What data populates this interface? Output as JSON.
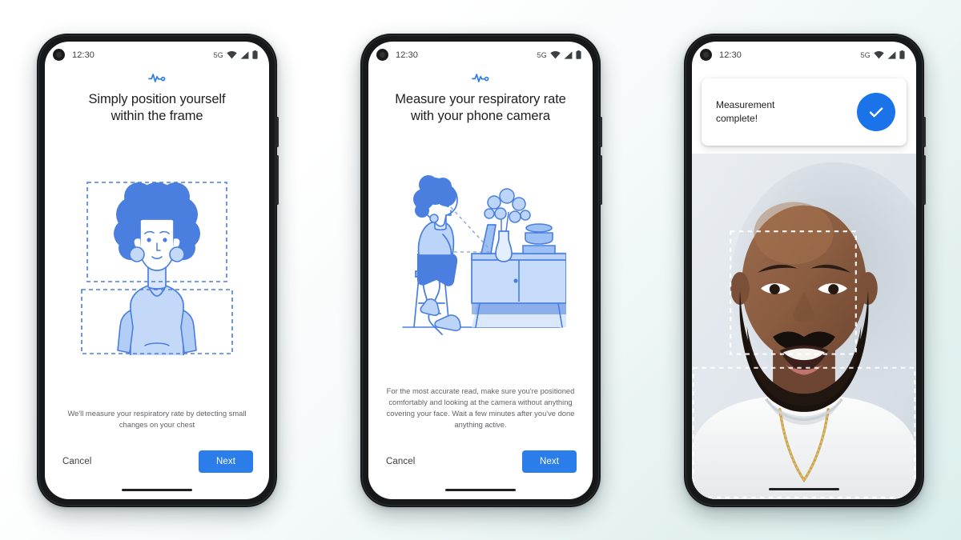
{
  "scene": {
    "background_start": "#ffffff",
    "background_end": "#dcefee",
    "phone_count": 3
  },
  "theme": {
    "accent_blue": "#2b7de9",
    "check_blue": "#1a73e8",
    "illustration_blue": "#4a7fe0",
    "illustration_light": "#bcd3f5",
    "text_primary": "#202124",
    "text_secondary": "#5f6368",
    "dashed_frame": "#4a7fe0"
  },
  "status_bar": {
    "time": "12:30",
    "network": "5G",
    "wifi_icon": "wifi-icon",
    "signal_icon": "cellular-signal-icon",
    "battery_icon": "battery-full-icon",
    "camera_icon": "front-camera-punch-hole"
  },
  "phones": [
    {
      "id": "phone-position",
      "pulse_icon": "respiratory-pulse-icon",
      "headline": "Simply position yourself\nwithin the frame",
      "illustration": "person-in-frame-illustration",
      "caption": "We'll measure your respiratory rate by detecting small changes on your chest",
      "cancel_label": "Cancel",
      "next_label": "Next"
    },
    {
      "id": "phone-intro",
      "pulse_icon": "respiratory-pulse-icon",
      "headline": "Measure your respiratory rate\nwith your phone camera",
      "illustration": "person-on-stool-with-phone-illustration",
      "caption": "For the most accurate read, make sure you're positioned comfortably and looking at the camera without anything covering your face. Wait a few minutes after you've done anything active.",
      "cancel_label": "Cancel",
      "next_label": "Next"
    },
    {
      "id": "phone-complete",
      "toast_text": "Measurement\ncomplete!",
      "toast_icon": "check-circle-icon",
      "camera_view": "live-camera-preview-with-tracking-frames",
      "tracking_frames": [
        "face-tracking-frame",
        "chest-tracking-frame"
      ]
    }
  ]
}
